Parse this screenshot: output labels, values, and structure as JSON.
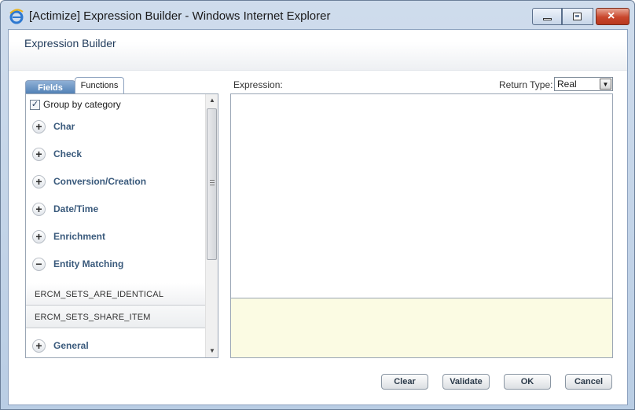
{
  "window": {
    "title": "[Actimize] Expression Builder - Windows Internet Explorer",
    "icon": "ie-icon",
    "controls": {
      "minimize": "minimize-icon",
      "maximize": "maximize-icon",
      "close": "×"
    }
  },
  "page": {
    "title": "Expression Builder"
  },
  "tabs": {
    "fields": "Fields",
    "functions": "Functions",
    "active": "Functions"
  },
  "functions_panel": {
    "group_by_label": "Group by category",
    "group_by_checked": true,
    "categories": [
      {
        "label": "Char",
        "expander": "+"
      },
      {
        "label": "Check",
        "expander": "+"
      },
      {
        "label": "Conversion/Creation",
        "expander": "+"
      },
      {
        "label": "Date/Time",
        "expander": "+"
      },
      {
        "label": "Enrichment",
        "expander": "+"
      },
      {
        "label": "Entity Matching",
        "expander": "−",
        "expanded": true,
        "functions": [
          "ERCM_SETS_ARE_IDENTICAL",
          "ERCM_SETS_SHARE_ITEM"
        ]
      },
      {
        "label": "General",
        "expander": "+"
      }
    ]
  },
  "expression": {
    "label": "Expression:",
    "value": "",
    "return_type_label": "Return Type:",
    "return_type_value": "Real"
  },
  "buttons": {
    "clear": "Clear",
    "validate": "Validate",
    "ok": "OK",
    "cancel": "Cancel"
  },
  "colors": {
    "category_text": "#3a5a7c",
    "message_bg": "#fbfbe3",
    "close_button": "#c9462c"
  }
}
